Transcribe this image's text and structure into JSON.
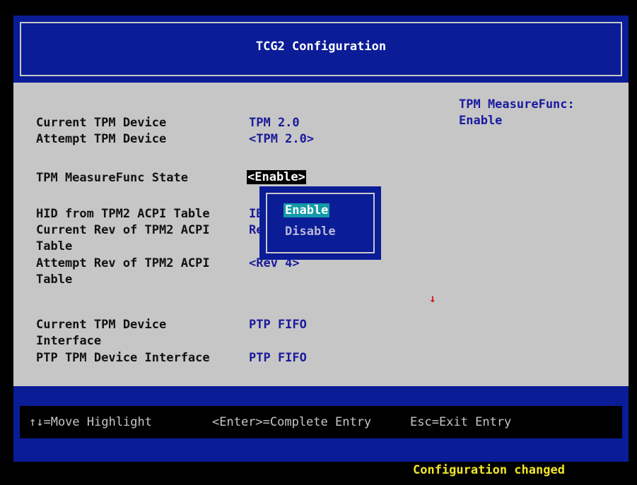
{
  "header": {
    "title": "TCG2 Configuration"
  },
  "settings": {
    "current_tpm_device": {
      "label": "Current TPM Device",
      "value": "TPM 2.0"
    },
    "attempt_tpm_device": {
      "label": "Attempt TPM Device",
      "value": "<TPM 2.0>"
    },
    "measure_func_state": {
      "label": "TPM MeasureFunc State",
      "value": "<Enable>"
    },
    "hid_acpi": {
      "label": "HID from TPM2 ACPI Table",
      "value": "IBM"
    },
    "current_rev": {
      "label_line1": "Current Rev of TPM2 ACPI",
      "label_line2": "Table",
      "value": "Rev"
    },
    "attempt_rev": {
      "label_line1": "Attempt Rev of TPM2 ACPI",
      "label_line2": "Table",
      "value": "<Rev 4>"
    },
    "current_interface": {
      "label_line1": "Current TPM Device",
      "label_line2": "Interface",
      "value": "PTP FIFO"
    },
    "ptp_interface": {
      "label": "PTP TPM Device Interface",
      "value": "PTP FIFO"
    }
  },
  "help": {
    "line1": "TPM MeasureFunc:",
    "line2": "Enable"
  },
  "popup": {
    "options": [
      "Enable",
      "Disable"
    ],
    "selected": "Enable"
  },
  "scroll_indicator": "↓",
  "footer": {
    "move": "↑↓=Move Highlight",
    "enter": "<Enter>=Complete Entry",
    "esc": "Esc=Exit Entry"
  },
  "status": "Configuration changed",
  "colors": {
    "background": "#000000",
    "bios_blue": "#0a1c96",
    "panel_gray": "#c6c6c6",
    "popup_highlight": "#129aa8",
    "status_yellow": "#f0e62a",
    "scroll_red": "#d81414"
  }
}
